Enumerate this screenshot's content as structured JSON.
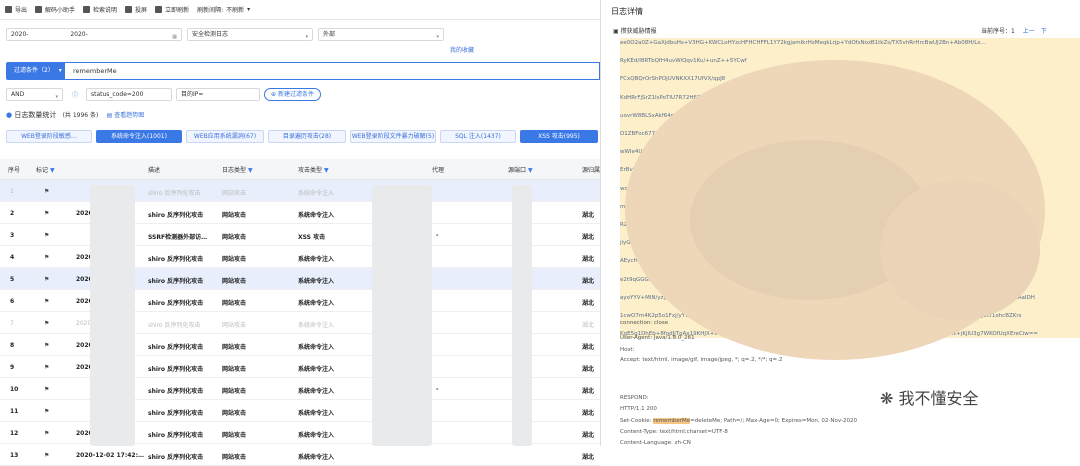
{
  "toolbar": {
    "export": "导出",
    "decode": "解码小助手",
    "check_desc": "检索说明",
    "screen": "投屏",
    "refresh": "立即刷新",
    "refresh_interval_label": "刷新间隔:",
    "refresh_interval_value": "不刷新"
  },
  "filters": {
    "date_from": "2020-",
    "date_to": "2020-",
    "log_type": "安全检测日志",
    "scope": "外部",
    "my_favorites": "我的收藏",
    "filter_cond_label": "过滤条件（2）",
    "filter_input": "rememberMe",
    "logic": "AND",
    "status_code": "status_code=200",
    "target_ip": "目的IP=",
    "new_filter": "新建过滤条件"
  },
  "stats": {
    "label": "日志数量统计",
    "count": "(共 1996 条)",
    "view_trend": "查看趋势图"
  },
  "tabs": [
    {
      "label": "WEB登录阶段敏感…"
    },
    {
      "label": "系统命令注入(1001)"
    },
    {
      "label": "WEB应用系统漏洞(67)"
    },
    {
      "label": "目录遍历攻击(28)"
    },
    {
      "label": "WEB登录阶段文件暴力破解(5)"
    },
    {
      "label": "SQL 注入(1437)"
    },
    {
      "label": "XSS 攻击(995)"
    }
  ],
  "columns": {
    "seq": "序号",
    "mark": "标记",
    "desc": "描述",
    "log_type": "日志类型",
    "attack_type": "攻击类型",
    "proxy": "代理",
    "target_port": "源端口",
    "city": "源归属地"
  },
  "rows": [
    {
      "seq": "1",
      "time": "",
      "desc": "shiro 反序列化攻击",
      "log_type": "网站攻击",
      "attack": "系统命令注入",
      "proxy": "",
      "city": "",
      "selected": true,
      "dim": true
    },
    {
      "seq": "2",
      "time": "2020",
      "desc": "shiro 反序列化攻击",
      "log_type": "网站攻击",
      "attack": "系统命令注入",
      "proxy": "",
      "city": "湖北",
      "selected": false,
      "dim": false
    },
    {
      "seq": "3",
      "time": "",
      "desc": "SSRF检测器外部访…",
      "log_type": "网站攻击",
      "attack": "XSS 攻击",
      "proxy": "-",
      "city": "湖北",
      "selected": false,
      "dim": false
    },
    {
      "seq": "4",
      "time": "2020",
      "desc": "shiro 反序列化攻击",
      "log_type": "网站攻击",
      "attack": "系统命令注入",
      "proxy": "",
      "city": "湖北",
      "selected": false,
      "dim": false
    },
    {
      "seq": "5",
      "time": "2020",
      "desc": "shiro 反序列化攻击",
      "log_type": "网站攻击",
      "attack": "系统命令注入",
      "proxy": "",
      "city": "湖北",
      "selected": true,
      "dim": false
    },
    {
      "seq": "6",
      "time": "2020",
      "desc": "shiro 反序列化攻击",
      "log_type": "网站攻击",
      "attack": "系统命令注入",
      "proxy": "",
      "city": "湖北",
      "selected": false,
      "dim": false
    },
    {
      "seq": "7",
      "time": "2020",
      "desc": "shiro 反序列化攻击",
      "log_type": "网站攻击",
      "attack": "系统命令注入",
      "proxy": "",
      "city": "湖北",
      "selected": false,
      "dim": true
    },
    {
      "seq": "8",
      "time": "2020",
      "desc": "shiro 反序列化攻击",
      "log_type": "网站攻击",
      "attack": "系统命令注入",
      "proxy": "",
      "city": "湖北",
      "selected": false,
      "dim": false
    },
    {
      "seq": "9",
      "time": "2020",
      "desc": "shiro 反序列化攻击",
      "log_type": "网站攻击",
      "attack": "系统命令注入",
      "proxy": "",
      "city": "湖北",
      "selected": false,
      "dim": false
    },
    {
      "seq": "10",
      "time": "",
      "desc": "shiro 反序列化攻击",
      "log_type": "网站攻击",
      "attack": "系统命令注入",
      "proxy": "-",
      "city": "湖北",
      "selected": false,
      "dim": false
    },
    {
      "seq": "11",
      "time": "",
      "desc": "shiro 反序列化攻击",
      "log_type": "网站攻击",
      "attack": "系统命令注入",
      "proxy": "",
      "city": "湖北",
      "selected": false,
      "dim": false
    },
    {
      "seq": "12",
      "time": "2020",
      "desc": "shiro 反序列化攻击",
      "log_type": "网站攻击",
      "attack": "系统命令注入",
      "proxy": "",
      "city": "湖北",
      "selected": false,
      "dim": false
    },
    {
      "seq": "13",
      "time": "2020-12-02 17:42:…",
      "desc": "shiro 反序列化攻击",
      "log_type": "网站攻击",
      "attack": "系统命令注入",
      "proxy": "",
      "city": "湖北",
      "selected": false,
      "dim": false
    }
  ],
  "detail": {
    "title": "日志详情",
    "subtitle": "攒获威胁情报",
    "page_label": "当前序号：",
    "page_value": "1",
    "prev": "上一",
    "next": "下",
    "lines_top": [
      "ee0O2a0Z+GaXjdbuHs+V3HG+KWCLoHYzcHFHCHFFL1Y72kgjamIkrHzMeqkLrjp+YdOfsNozB1tkZs/TX5vhRrHrcBwUJ2Bn+Ab08H/Lx...",
      "RyKEd/I8RTbQfH4uvWiQqv1Ku/+unZ++5YCwf",
      "FCxQBQrOrShPOjUVNKXX17UfVX/qpJ8",
      "KdHRrFjSrZ1IsPoTIU7R72H62jUtfYMvh",
      "uovrW8BLSxAkf64purbQg4Uhuj72",
      "D1ZBFoc677OxVtaRd4rhtszJvC6",
      "wWle4UnHW/2AxapvAvZhW",
      "ErBv3yLidrgkH6OH9pfr",
      "wcKtAznqMr+lOYl4U",
      "mvATWWRh2+lO2H",
      "RZhs76BmbAIENP",
      "jiyGDUmixECqqzFCk",
      "AEycHvq9yyi0zHc5OXuX",
      "e2t9qGGGK+ccxtOYQzQvLS8HhkxN",
      "ayoYYV+MiN/yzyNEB6VqLKcIL/nd9RRw6M9BH6vGSnwgtmUsEHXsgG2h3K+fsR6kv6CNdTvyRqNyKFb+i0m/kJ1w6PKS/61QbVyaUFB52yyuZXEGbZAaIDH",
      "1cwO7m4K2p5o1Fxj/yYWe/wQnAk2Ai/y3T9HRVA695/XFeNZY0Me2zQZ/flrC4zw0f4nK4b5cK6HgdR4nrQxs9C49K+QOO5kRr1e+Fns1/J5cf1ohcBZKrs",
      "KgE5q1DhEb+8fodJjTgAx19KHJX+IMLLoMZAx6GjIwXPFP1WZw57Gw8WZu6/TJrMIFkZ6UpjGIBJK9iorHVGMPMmWwAIPSApW+jKjIU3g7WKOfUqXEreCiw=="
    ],
    "lines_bottom": [
      "connection: close",
      "User-Agent: Java/1.8.0_261",
      "Host:",
      "Accept: text/html, image/gif, image/jpeg, *; q=.2, */*; q=.2",
      "RESPOND:",
      "HTTP/1.1 200",
      "Set-Cookie: ",
      "rememberMe",
      "=deleteMe; Path=/; Max-Age=0; Expires=Mon, 02-Nov-2020",
      "Content-Type: text/html;charset=UTF-8",
      "Content-Language: zh-CN"
    ],
    "watermark": "我不懂安全"
  },
  "colors": {
    "accent": "#3a78e6",
    "highlight": "#fcefc9",
    "selected_row": "#e8eefb"
  }
}
